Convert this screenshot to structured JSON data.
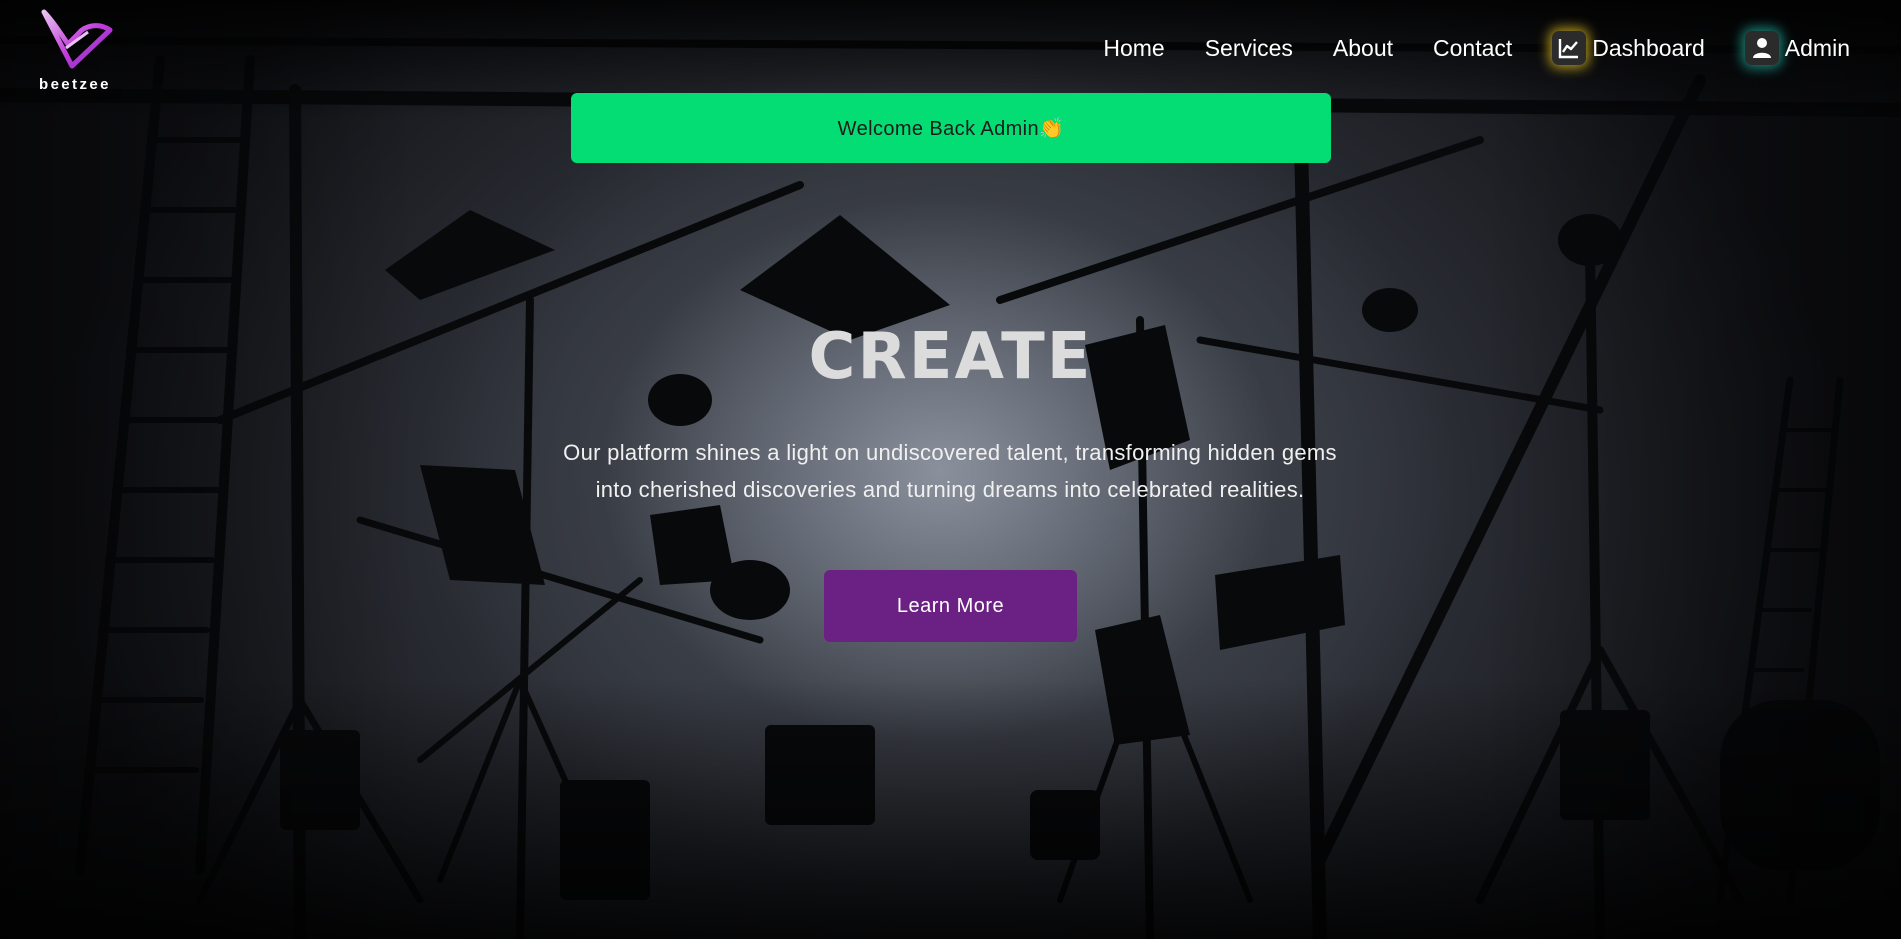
{
  "brand": {
    "name": "beetzee",
    "logo_color": "#c23ddb"
  },
  "nav": {
    "links": [
      "Home",
      "Services",
      "About",
      "Contact"
    ],
    "dashboard": {
      "label": "Dashboard",
      "icon": "chart-line-icon",
      "glow": "#ebc828"
    },
    "admin": {
      "label": "Admin",
      "icon": "user-icon",
      "glow": "#28dcc8"
    }
  },
  "banner": {
    "text": "Welcome Back Admin👏",
    "color": "#03dd74"
  },
  "hero": {
    "title": "CREATE",
    "description": "Our platform shines a light on undiscovered talent, transforming hidden gems into cherished discoveries and turning dreams into celebrated realities.",
    "cta_label": "Learn More",
    "cta_color": "#6b2084"
  }
}
